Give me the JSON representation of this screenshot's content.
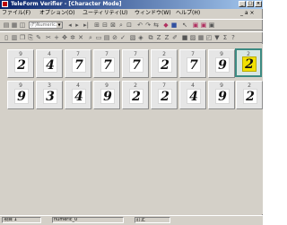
{
  "window": {
    "title": "TeleForm Verifier - [Character Mode]",
    "controls": [
      "_",
      "□",
      "×"
    ]
  },
  "menubar": {
    "items": [
      "ファイル(F)",
      "オプション(O)",
      "ユーティリティ(U)",
      "ウィンドウ(W)",
      "ヘルプ(H)"
    ],
    "mdi_controls": "_ a ×"
  },
  "toolbar1": {
    "select_value": "(F)Numeric..."
  },
  "grid": {
    "rows": [
      {
        "cells": [
          {
            "label": "9",
            "digit": "2",
            "selected": false
          },
          {
            "label": "4",
            "digit": "4",
            "selected": false
          },
          {
            "label": "7",
            "digit": "7",
            "selected": false
          },
          {
            "label": "7",
            "digit": "7",
            "selected": false
          },
          {
            "label": "7",
            "digit": "7",
            "selected": false
          },
          {
            "label": "2",
            "digit": "2",
            "selected": false
          },
          {
            "label": "7",
            "digit": "7",
            "selected": false
          },
          {
            "label": "9",
            "digit": "9",
            "selected": false
          },
          {
            "label": "2",
            "digit": "2",
            "selected": true
          }
        ]
      },
      {
        "cells": [
          {
            "label": "9",
            "digit": "9",
            "selected": false
          },
          {
            "label": "3",
            "digit": "3",
            "selected": false
          },
          {
            "label": "4",
            "digit": "4",
            "selected": false
          },
          {
            "label": "9",
            "digit": "9",
            "selected": false
          },
          {
            "label": "2",
            "digit": "2",
            "selected": false
          },
          {
            "label": "7",
            "digit": "2",
            "selected": false
          },
          {
            "label": "4",
            "digit": "4",
            "selected": false
          },
          {
            "label": "9",
            "digit": "9",
            "selected": false
          },
          {
            "label": "2",
            "digit": "2",
            "selected": false
          }
        ]
      }
    ]
  },
  "statusbar": {
    "field_count": "項目 1",
    "field_name": "numeric_0",
    "mode": "訂正"
  },
  "colors": {
    "titlebar_start": "#0a246a",
    "titlebar_end": "#a6caf0",
    "selected_border": "#3c8a82",
    "selected_fill": "#f2e000"
  }
}
